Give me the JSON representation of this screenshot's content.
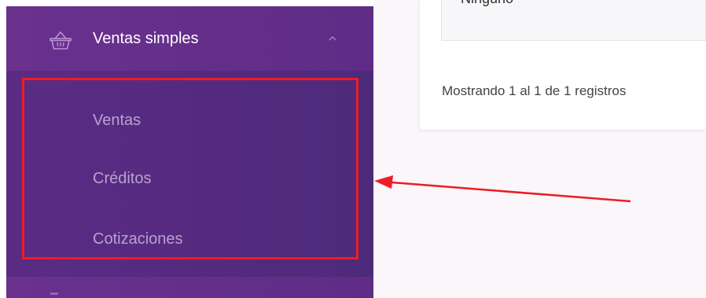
{
  "sidebar": {
    "menu_item": {
      "label": "Ventas simples",
      "icon": "basket-icon",
      "expanded": true
    },
    "submenu": [
      {
        "label": "Ventas"
      },
      {
        "label": "Créditos"
      },
      {
        "label": "Cotizaciones"
      }
    ]
  },
  "main": {
    "field_value": "Ninguno",
    "records_info": "Mostrando 1 al 1 de 1 registros"
  },
  "colors": {
    "sidebar_purple": "#6a2f8e",
    "submenu_text": "#b9a2cf",
    "highlight_red": "#ee1c24"
  }
}
